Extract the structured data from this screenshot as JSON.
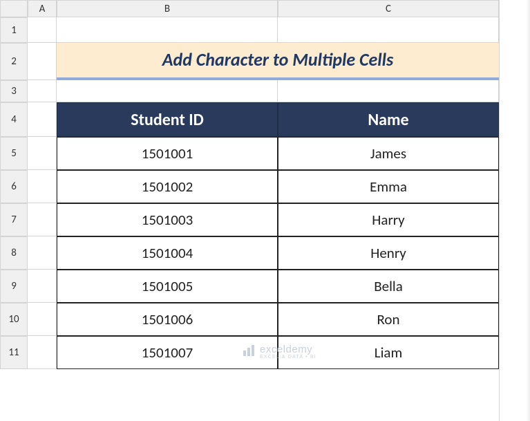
{
  "columns": [
    "A",
    "B",
    "C"
  ],
  "rows": [
    "1",
    "2",
    "3",
    "4",
    "5",
    "6",
    "7",
    "8",
    "9",
    "10",
    "11"
  ],
  "title": "Add Character to Multiple Cells",
  "table": {
    "headers": {
      "id": "Student ID",
      "name": "Name"
    },
    "data": [
      {
        "id": "1501001",
        "name": "James"
      },
      {
        "id": "1501002",
        "name": "Emma"
      },
      {
        "id": "1501003",
        "name": "Harry"
      },
      {
        "id": "1501004",
        "name": "Henry"
      },
      {
        "id": "1501005",
        "name": "Bella"
      },
      {
        "id": "1501006",
        "name": "Ron"
      },
      {
        "id": "1501007",
        "name": "Liam"
      }
    ]
  },
  "watermark": {
    "main": "exceldemy",
    "sub": "EXCEL & DATA • BI"
  },
  "chart_data": {
    "type": "table",
    "title": "Add Character to Multiple Cells",
    "columns": [
      "Student ID",
      "Name"
    ],
    "rows": [
      [
        "1501001",
        "James"
      ],
      [
        "1501002",
        "Emma"
      ],
      [
        "1501003",
        "Harry"
      ],
      [
        "1501004",
        "Henry"
      ],
      [
        "1501005",
        "Bella"
      ],
      [
        "1501006",
        "Ron"
      ],
      [
        "1501007",
        "Liam"
      ]
    ]
  }
}
